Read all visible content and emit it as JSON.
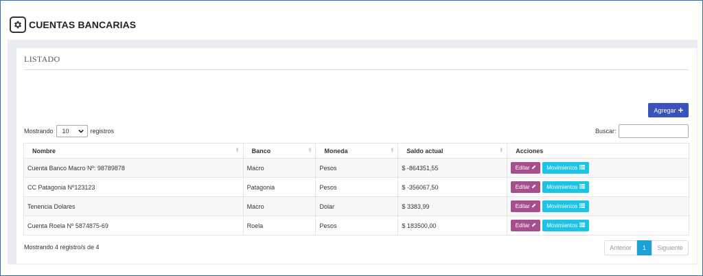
{
  "header": {
    "title": "CUENTAS BANCARIAS",
    "icon": "gear-icon"
  },
  "section": {
    "title": "LISTADO"
  },
  "toolbar": {
    "add_label": "Agregar"
  },
  "length_menu": {
    "prefix": "Mostrando",
    "selected": "10",
    "suffix": "registros"
  },
  "search": {
    "label": "Buscar:",
    "value": "",
    "placeholder": ""
  },
  "table": {
    "columns": [
      "Nombre",
      "Banco",
      "Moneda",
      "Saldo actual",
      "Acciones"
    ],
    "rows": [
      {
        "nombre": "Cuenta Banco Macro Nº: 98789878",
        "banco": "Macro",
        "moneda": "Pesos",
        "saldo": "$ -864351,55"
      },
      {
        "nombre": "CC Patagonia Nº123123",
        "banco": "Patagonia",
        "moneda": "Pesos",
        "saldo": "$ -356067,50"
      },
      {
        "nombre": "Tenencia Dolares",
        "banco": "Macro",
        "moneda": "Dolar",
        "saldo": "$ 3383,99"
      },
      {
        "nombre": "Cuenta Roela Nº 5874875-69",
        "banco": "Roela",
        "moneda": "Pesos",
        "saldo": "$ 183500,00"
      }
    ],
    "edit_label": "Editar",
    "movements_label": "Movimientos"
  },
  "footer": {
    "info": "Mostrando 4 registro/s de 4"
  },
  "pagination": {
    "prev": "Anterior",
    "current": "1",
    "next": "Siguiente"
  },
  "colors": {
    "add_button": "#3a53b8",
    "edit_button": "#a64f8e",
    "movements_button": "#1cc3e4",
    "active_page": "#1ba0d8",
    "frame_border": "#2f6db5"
  }
}
